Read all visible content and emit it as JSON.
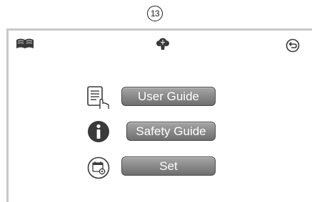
{
  "callout": {
    "number": "13"
  },
  "topbar": {
    "left_icon": "book-icon",
    "center_icon": "brain-icon",
    "right_icon": "back-icon"
  },
  "menu": {
    "items": [
      {
        "label": "User Guide",
        "icon": "document-hand-icon"
      },
      {
        "label": "Safety Guide",
        "icon": "info-icon"
      },
      {
        "label": "Set",
        "icon": "calendar-settings-icon"
      }
    ]
  },
  "colors": {
    "frame": "#c8c8c8",
    "button_top": "#a7a7a7",
    "button_bottom": "#6f6f6f",
    "icon": "#3a3a3a"
  }
}
